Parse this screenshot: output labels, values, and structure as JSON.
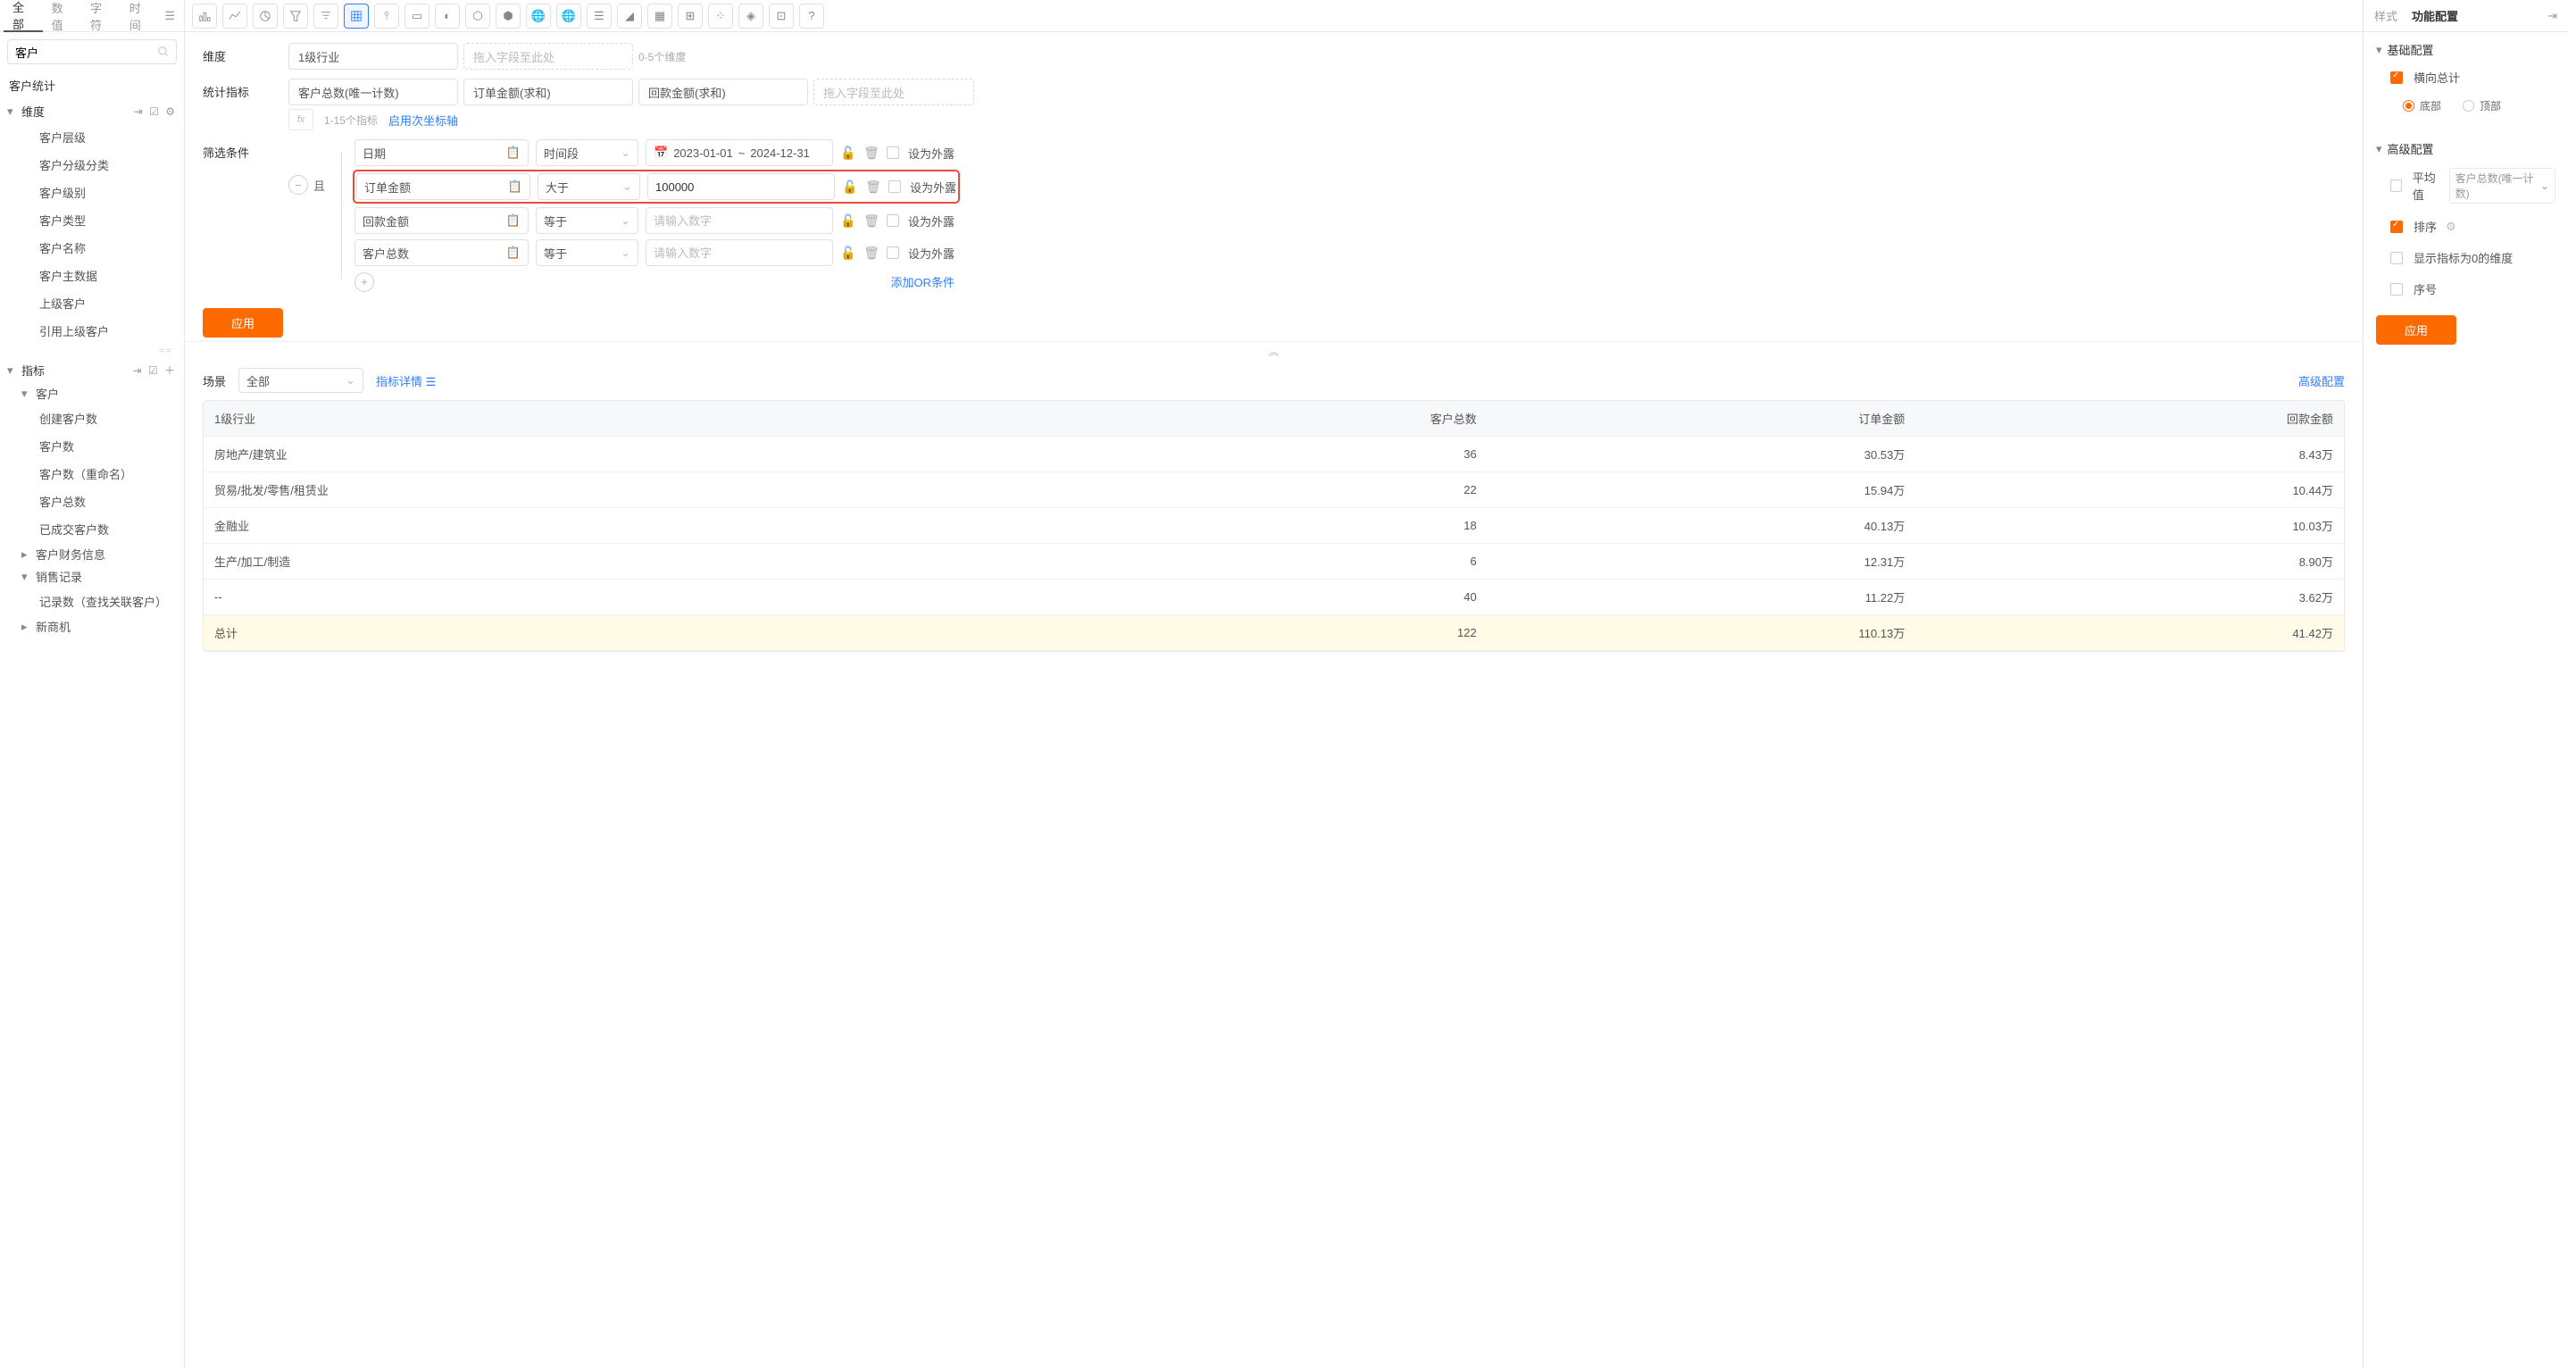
{
  "leftTabs": {
    "all": "全部",
    "num": "数值",
    "char": "字符",
    "time": "时间"
  },
  "search": {
    "placeholder": "客户"
  },
  "leftTitle": "客户统计",
  "sections": {
    "dim": {
      "label": "维度",
      "items": [
        "客户层级",
        "客户分级分类",
        "客户级别",
        "客户类型",
        "客户名称",
        "客户主数据",
        "上级客户",
        "引用上级客户"
      ]
    },
    "metric": {
      "label": "指标",
      "customer": {
        "label": "客户",
        "items": [
          "创建客户数",
          "客户数",
          "客户数（重命名）",
          "客户总数",
          "已成交客户数"
        ]
      },
      "finance": "客户财务信息",
      "sales": {
        "label": "销售记录",
        "items": [
          "记录数（查找关联客户）"
        ]
      },
      "opp": "新商机"
    }
  },
  "center": {
    "dimLabel": "维度",
    "dimChip": "1级行业",
    "dimPlaceholder": "拖入字段至此处",
    "dimHint": "0-5个维度",
    "metricLabel": "统计指标",
    "metricChips": [
      "客户总数(唯一计数)",
      "订单金额(求和)",
      "回款金额(求和)"
    ],
    "metricPlaceholder": "拖入字段至此处",
    "fxHint": "1-15个指标",
    "secondaryAxisLink": "启用次坐标轴",
    "filterLabel": "筛选条件",
    "andLabel": "且",
    "exposeLabel": "设为外露",
    "filters": [
      {
        "field": "日期",
        "op": "时间段",
        "val1": "2023-01-01",
        "valSep": "~",
        "val2": "2024-12-31",
        "type": "date"
      },
      {
        "field": "订单金额",
        "op": "大于",
        "val": "100000",
        "type": "num",
        "hl": true
      },
      {
        "field": "回款金额",
        "op": "等于",
        "val": "",
        "ph": "请输入数字",
        "type": "num"
      },
      {
        "field": "客户总数",
        "op": "等于",
        "val": "",
        "ph": "请输入数字",
        "type": "num"
      }
    ],
    "addOr": "添加OR条件",
    "applyBtn": "应用",
    "sceneLabel": "场景",
    "sceneValue": "全部",
    "indicatorDetail": "指标详情",
    "advancedConfig": "高级配置"
  },
  "table": {
    "cols": [
      "1级行业",
      "客户总数",
      "订单金额",
      "回款金额"
    ],
    "rows": [
      [
        "房地产/建筑业",
        "36",
        "30.53万",
        "8.43万"
      ],
      [
        "贸易/批发/零售/租赁业",
        "22",
        "15.94万",
        "10.44万"
      ],
      [
        "金融业",
        "18",
        "40.13万",
        "10.03万"
      ],
      [
        "生产/加工/制造",
        "6",
        "12.31万",
        "8.90万"
      ],
      [
        "--",
        "40",
        "11.22万",
        "3.62万"
      ]
    ],
    "total": [
      "总计",
      "122",
      "110.13万",
      "41.42万"
    ]
  },
  "right": {
    "styleTab": "样式",
    "funcTab": "功能配置",
    "basic": "基础配置",
    "horizTotal": "横向总计",
    "bottom": "底部",
    "top": "顶部",
    "advanced": "高级配置",
    "avg": "平均值",
    "avgSelect": "客户总数(唯一计数)",
    "sort": "排序",
    "showZero": "显示指标为0的维度",
    "serial": "序号",
    "apply": "应用"
  }
}
